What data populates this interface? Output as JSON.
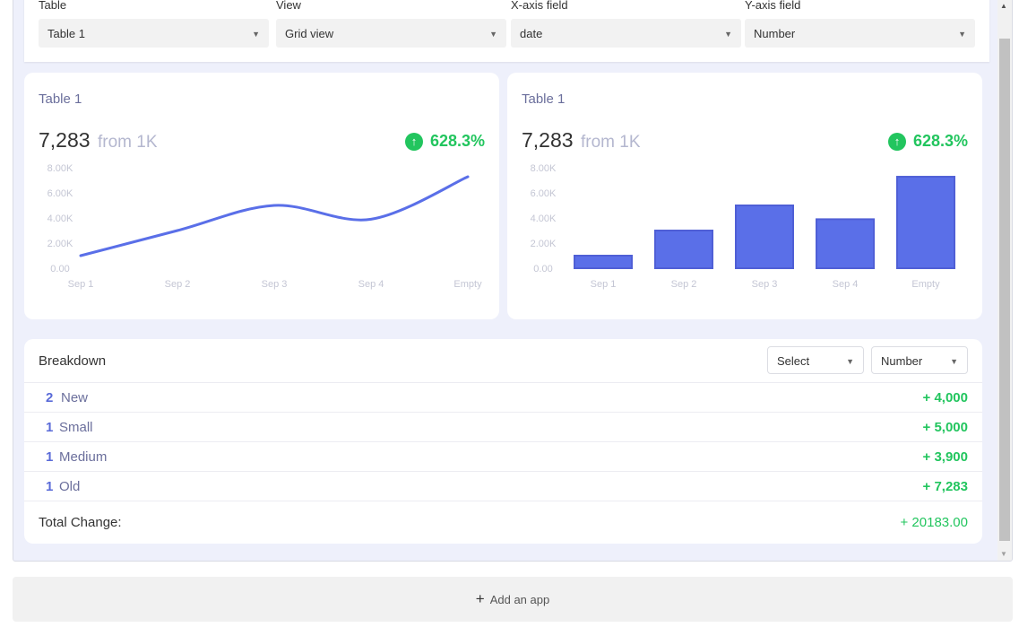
{
  "config": {
    "fields": [
      {
        "label": "Table",
        "value": "Table 1"
      },
      {
        "label": "View",
        "value": "Grid view"
      },
      {
        "label": "X-axis field",
        "value": "date"
      },
      {
        "label": "Y-axis field",
        "value": "Number"
      }
    ]
  },
  "cards": [
    {
      "title": "Table 1",
      "big_number": "7,283",
      "from_text": "from 1K",
      "change": "628.3%"
    },
    {
      "title": "Table 1",
      "big_number": "7,283",
      "from_text": "from 1K",
      "change": "628.3%"
    }
  ],
  "chart_data": [
    {
      "type": "line",
      "categories": [
        "Sep 1",
        "Sep 2",
        "Sep 3",
        "Sep 4",
        "Empty"
      ],
      "values": [
        1000,
        3000,
        5000,
        3900,
        7283
      ],
      "ylim": [
        0,
        8000
      ],
      "yticks": [
        "0.00",
        "2.00K",
        "4.00K",
        "6.00K",
        "8.00K"
      ],
      "color": "#5a6fe8",
      "grid": false
    },
    {
      "type": "bar",
      "categories": [
        "Sep 1",
        "Sep 2",
        "Sep 3",
        "Sep 4",
        "Empty"
      ],
      "values": [
        1000,
        3000,
        5000,
        3900,
        7283
      ],
      "ylim": [
        0,
        8000
      ],
      "yticks": [
        "0.00",
        "2.00K",
        "4.00K",
        "6.00K",
        "8.00K"
      ],
      "color": "#5a6fe8",
      "grid": false
    }
  ],
  "breakdown": {
    "title": "Breakdown",
    "select_label": "Select",
    "number_label": "Number",
    "rows": [
      {
        "count": "2",
        "name": "New",
        "value": "+ 4,000"
      },
      {
        "count": "1",
        "name": "Small",
        "value": "+ 5,000"
      },
      {
        "count": "1",
        "name": "Medium",
        "value": "+ 3,900"
      },
      {
        "count": "1",
        "name": "Old",
        "value": "+ 7,283"
      }
    ],
    "total_label": "Total Change:",
    "total_value": "+ 20183.00"
  },
  "add_app": {
    "label": "Add an app",
    "icon": "plus-icon"
  },
  "colors": {
    "accent": "#5a6fe8",
    "positive": "#22c55e",
    "background": "#eef0fb"
  }
}
